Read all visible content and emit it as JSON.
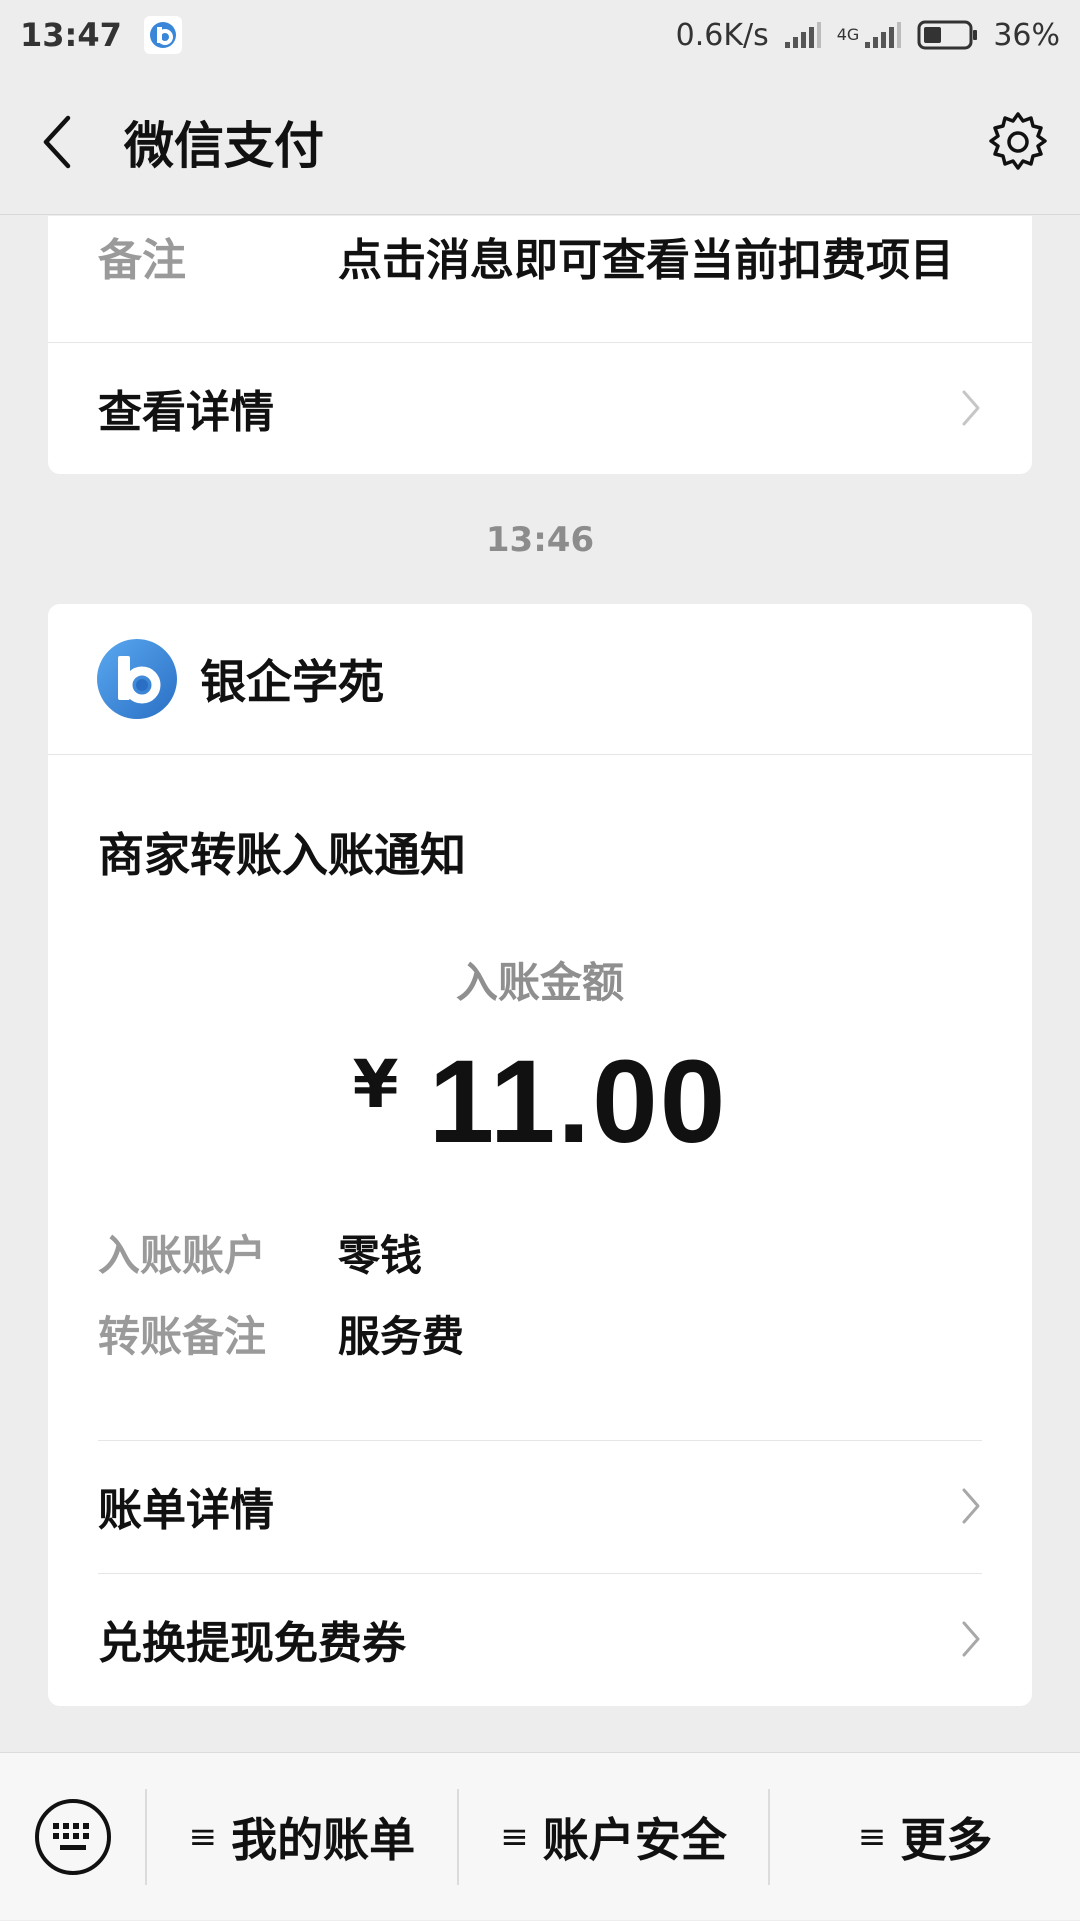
{
  "status_bar": {
    "time": "13:47",
    "net_speed": "0.6K/s",
    "network_type": "4G",
    "battery": "36%"
  },
  "nav": {
    "title": "微信支付",
    "back_icon": "chevron-left-icon",
    "settings_icon": "gear-icon"
  },
  "previous_card": {
    "remark_label": "备注",
    "remark_value": "点击消息即可查看当前扣费项目",
    "view_details": "查看详情"
  },
  "timestamp": "13:46",
  "notification": {
    "merchant_name": "银企学苑",
    "title": "商家转账入账通知",
    "amount_label": "入账金额",
    "currency": "¥",
    "amount": "11.00",
    "account_label": "入账账户",
    "account_value": "零钱",
    "note_label": "转账备注",
    "note_value": "服务费",
    "bill_details": "账单详情",
    "coupon": "兑换提现免费券"
  },
  "bottom_menu": {
    "menu_glyph": "≡",
    "items": [
      "我的账单",
      "账户安全",
      "更多"
    ]
  },
  "colors": {
    "background": "#ededed",
    "card": "#ffffff",
    "brand_blue": "#3a86d8"
  }
}
